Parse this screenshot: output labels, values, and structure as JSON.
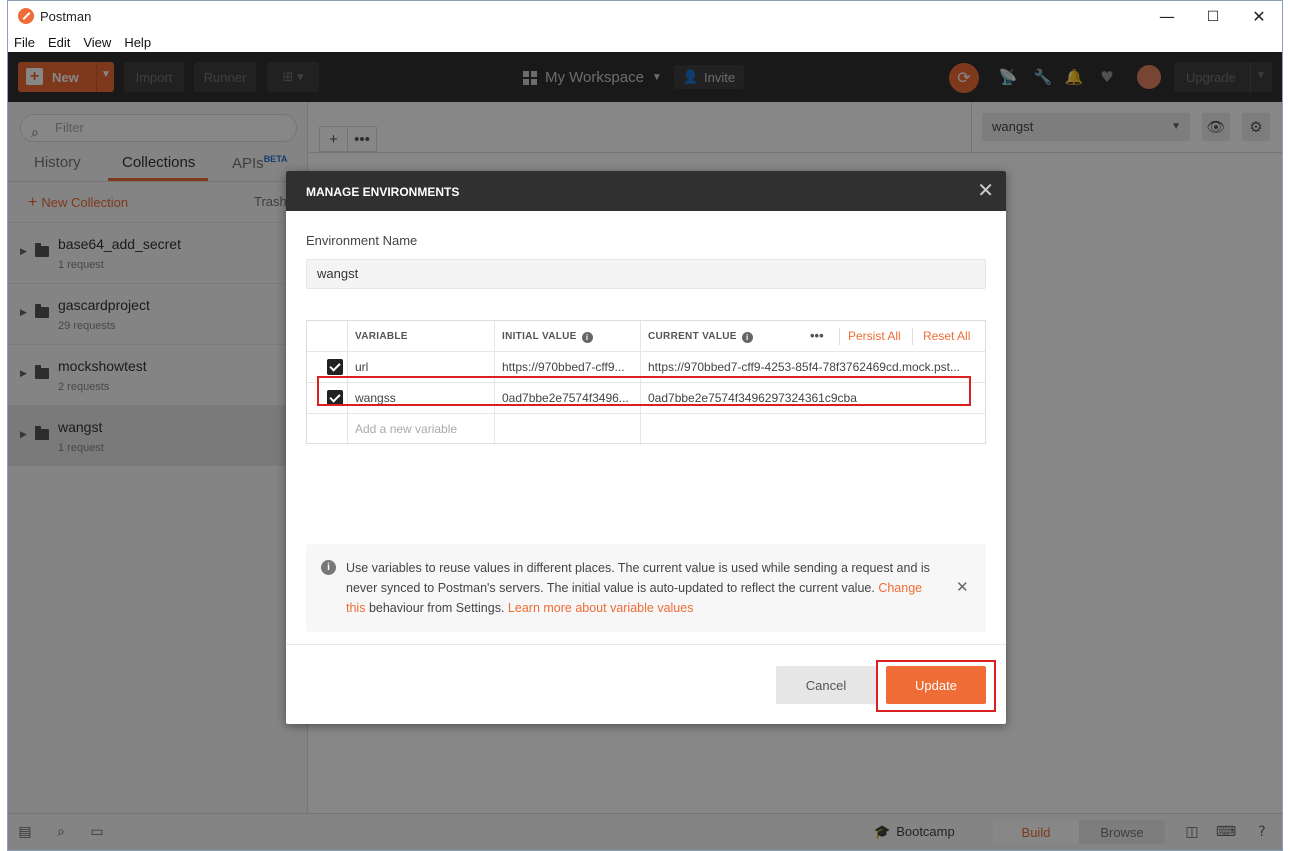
{
  "window": {
    "title": "Postman",
    "minimize": "—",
    "maximize": "☐",
    "close": "✕"
  },
  "menu": [
    "File",
    "Edit",
    "View",
    "Help"
  ],
  "toolbar": {
    "new_label": "New",
    "import_label": "Import",
    "runner_label": "Runner",
    "workspace_label": "My Workspace",
    "invite_label": "Invite",
    "upgrade_label": "Upgrade"
  },
  "sidebar": {
    "filter_placeholder": "Filter",
    "tabs": {
      "history": "History",
      "collections": "Collections",
      "apis": "APIs",
      "apis_badge": "BETA"
    },
    "new_collection": "New Collection",
    "trash": "Trash",
    "collections": [
      {
        "name": "base64_add_secret",
        "count": "1 request"
      },
      {
        "name": "gascardproject",
        "count": "29 requests"
      },
      {
        "name": "mockshowtest",
        "count": "2 requests"
      },
      {
        "name": "wangst",
        "count": "1 request"
      }
    ]
  },
  "environment_selector": {
    "selected": "wangst"
  },
  "statusbar": {
    "bootcamp": "Bootcamp",
    "build": "Build",
    "browse": "Browse"
  },
  "modal": {
    "title": "MANAGE ENVIRONMENTS",
    "env_name_label": "Environment Name",
    "env_name_value": "wangst",
    "columns": {
      "variable": "VARIABLE",
      "initial": "INITIAL VALUE",
      "current": "CURRENT VALUE",
      "more": "•••",
      "persist_all": "Persist All",
      "reset_all": "Reset All"
    },
    "rows": [
      {
        "variable": "url",
        "initial": "https://970bbed7-cff9...",
        "current": "https://970bbed7-cff9-4253-85f4-78f3762469cd.mock.pst..."
      },
      {
        "variable": "wangss",
        "initial": "0ad7bbe2e7574f3496...",
        "current": "0ad7bbe2e7574f3496297324361c9cba"
      }
    ],
    "add_placeholder": "Add a new variable",
    "notice": {
      "text1": "Use variables to reuse values in different places. The current value is used while sending a request and is never synced to Postman's servers. The initial value is auto-updated to reflect the current value.",
      "link1": "Change this",
      "text2": "behaviour from Settings.",
      "link2": "Learn more about variable values"
    },
    "cancel_label": "Cancel",
    "update_label": "Update"
  },
  "colors": {
    "accent": "#ef6c36",
    "header_dark": "#303030",
    "highlight_box": "#d92121"
  }
}
